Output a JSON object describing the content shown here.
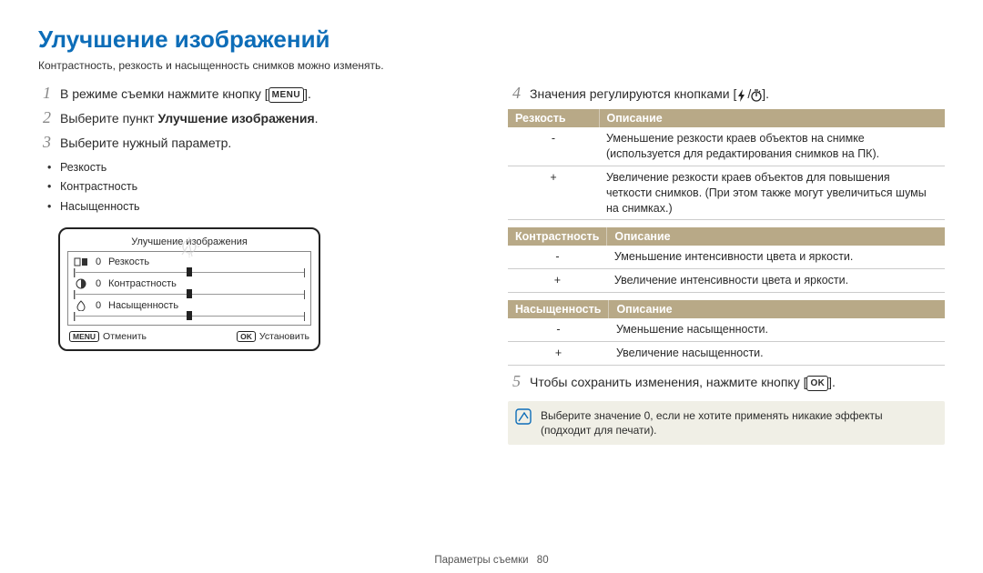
{
  "title": "Улучшение изображений",
  "subtitle": "Контрастность, резкость и насыщенность снимков можно изменять.",
  "steps": {
    "s1": {
      "num": "1",
      "text_a": "В режиме съемки нажмите кнопку [",
      "menu_label": "MENU",
      "text_b": "]."
    },
    "s2": {
      "num": "2",
      "text_a": "Выберите пункт ",
      "bold": "Улучшение изображения",
      "text_b": "."
    },
    "s3": {
      "num": "3",
      "text": "Выберите нужный параметр.",
      "items": [
        "Резкость",
        "Контрастность",
        "Насыщенность"
      ]
    },
    "s4": {
      "num": "4",
      "text_a": "Значения регулируются кнопками [",
      "sep": "/",
      "text_b": "]."
    },
    "s5": {
      "num": "5",
      "text_a": "Чтобы сохранить изменения, нажмите кнопку [",
      "ok_label": "OK",
      "text_b": "]."
    }
  },
  "lcd": {
    "title": "Улучшение изображения",
    "rows": [
      {
        "value": "0",
        "label": "Резкость"
      },
      {
        "value": "0",
        "label": "Контрастность"
      },
      {
        "value": "0",
        "label": "Насыщенность"
      }
    ],
    "cancel_btn": "MENU",
    "cancel_text": "Отменить",
    "ok_btn": "OK",
    "ok_text": "Установить"
  },
  "tables": {
    "sharp": {
      "h1": "Резкость",
      "h2": "Описание",
      "rows": [
        {
          "sign": "-",
          "desc": "Уменьшение резкости краев объектов на снимке (используется для редактирования снимков на ПК)."
        },
        {
          "sign": "+",
          "desc": "Увеличение резкости краев объектов для повышения четкости снимков. (При этом также могут увеличиться шумы на снимках.)"
        }
      ]
    },
    "contrast": {
      "h1": "Контрастность",
      "h2": "Описание",
      "rows": [
        {
          "sign": "-",
          "desc": "Уменьшение интенсивности цвета и яркости."
        },
        {
          "sign": "+",
          "desc": "Увеличение интенсивности цвета и яркости."
        }
      ]
    },
    "sat": {
      "h1": "Насыщенность",
      "h2": "Описание",
      "rows": [
        {
          "sign": "-",
          "desc": "Уменьшение насыщенности."
        },
        {
          "sign": "+",
          "desc": "Увеличение насыщенности."
        }
      ]
    }
  },
  "note": "Выберите значение 0, если не хотите применять никакие эффекты (подходит для печати).",
  "footer": {
    "section": "Параметры съемки",
    "page": "80"
  }
}
